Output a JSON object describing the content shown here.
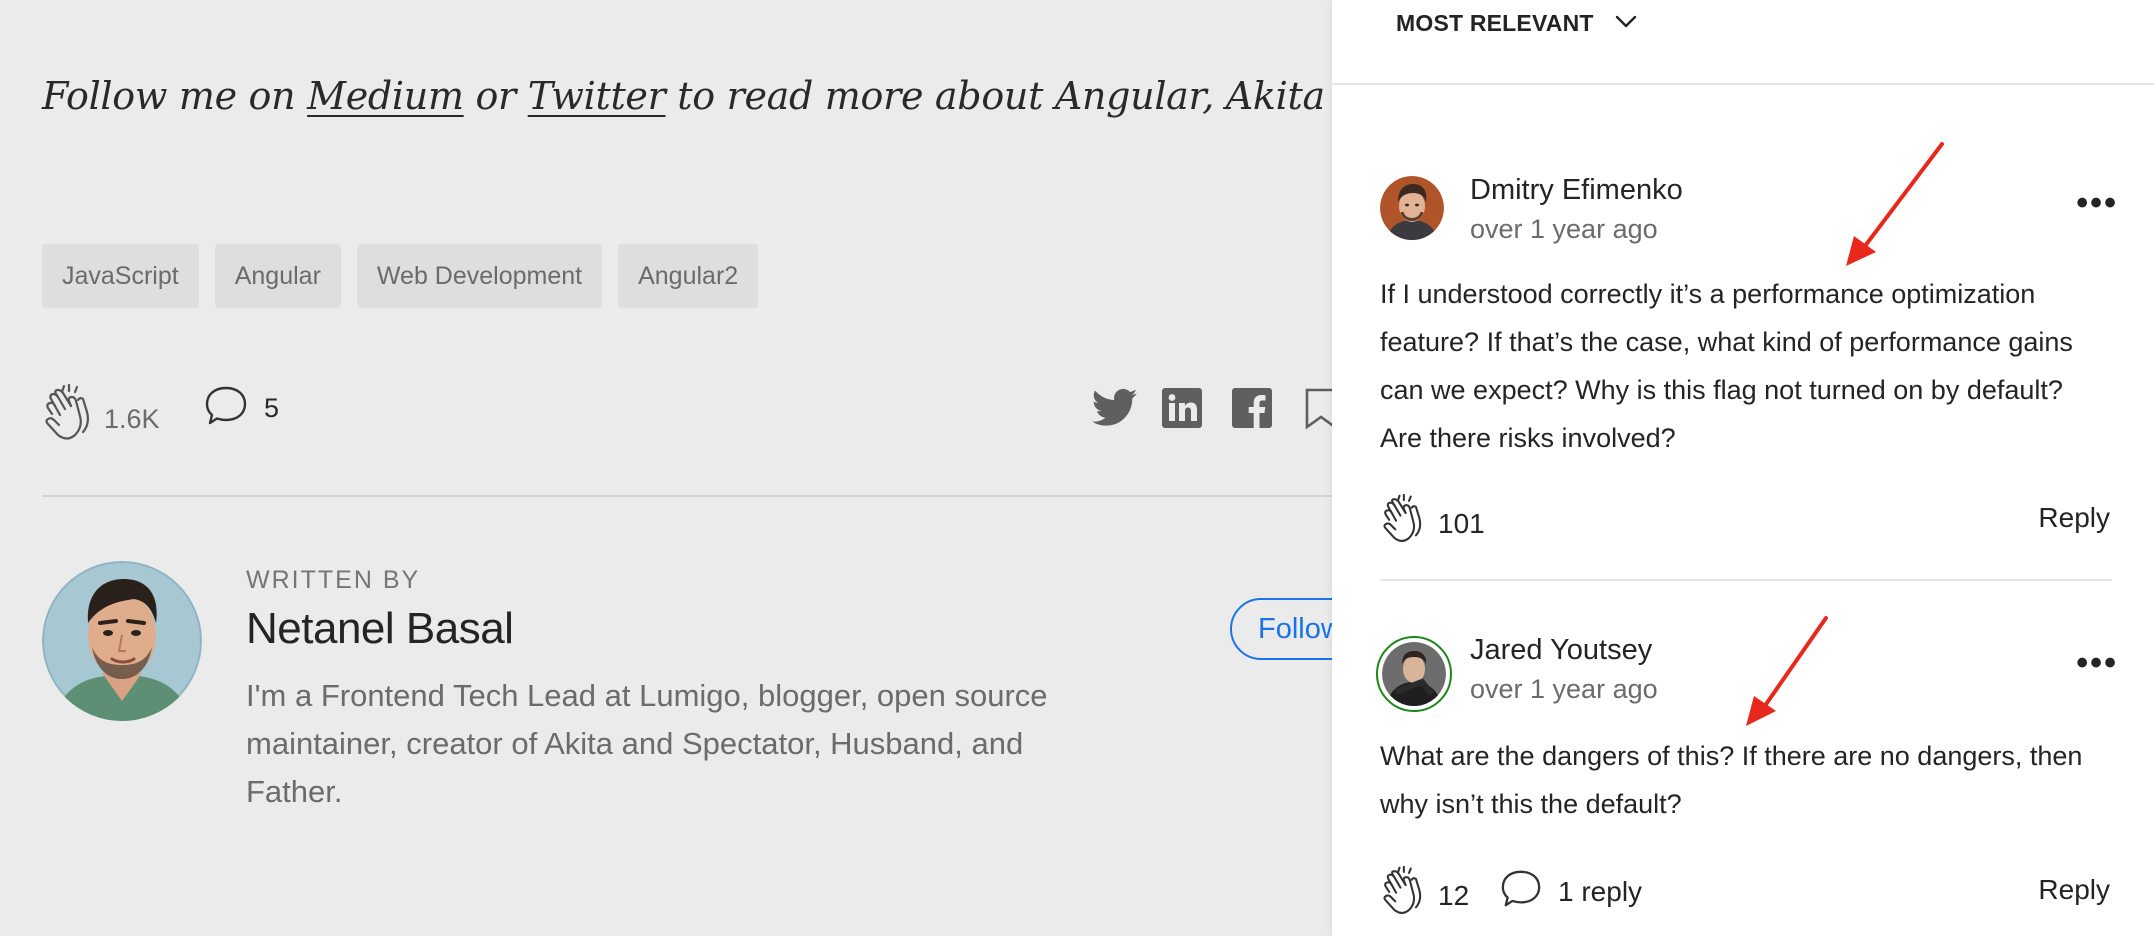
{
  "article": {
    "follow_prefix": "Follow me on ",
    "follow_link1": "Medium",
    "follow_mid": " or ",
    "follow_link2": "Twitter",
    "follow_suffix": " to read more about Angular, Akita and JS!",
    "tags": [
      "JavaScript",
      "Angular",
      "Web Development",
      "Angular2"
    ],
    "claps": "1.6K",
    "responses": "5",
    "share_icons": [
      "twitter-icon",
      "linkedin-icon",
      "facebook-icon",
      "bookmark-icon"
    ]
  },
  "author": {
    "written_by": "WRITTEN BY",
    "name": "Netanel Basal",
    "bio": "I'm a Frontend Tech Lead at Lumigo, blogger, open source maintainer, creator of Akita and Spectator, Husband, and Father.",
    "follow_label": "Follow"
  },
  "responses_panel": {
    "sort_label": "MOST RELEVANT",
    "comments": [
      {
        "author": "Dmitry Efimenko",
        "time": "over 1 year ago",
        "text": "If I understood correctly it’s a performance optimization feature? If that’s the case, what kind of performance gains can we expect? Why is this flag not turned on by default? Are there risks involved?",
        "claps": "101",
        "reply_label": "Reply"
      },
      {
        "author": "Jared Youtsey",
        "time": "over 1 year ago",
        "text": "What are the dangers of this? If there are no dangers, then why isn’t this the default?",
        "claps": "12",
        "replies": "1 reply",
        "reply_label": "Reply"
      }
    ]
  },
  "colors": {
    "page_bg": "#ebebeb",
    "panel_bg": "#ffffff",
    "link_blue": "#1a73e8",
    "annotation_red": "#e8281c"
  }
}
